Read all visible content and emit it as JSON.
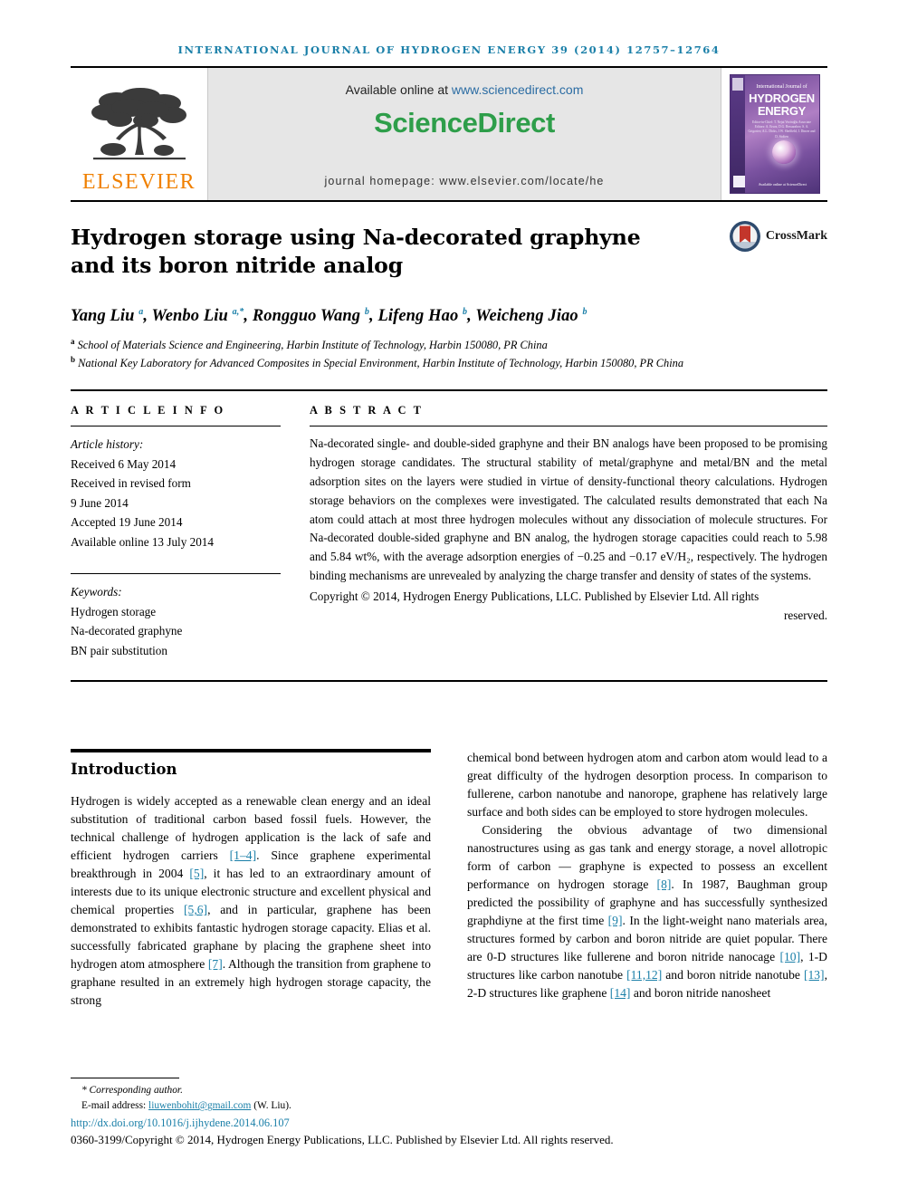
{
  "running_head": "INTERNATIONAL JOURNAL OF HYDROGEN ENERGY 39 (2014) 12757–12764",
  "masthead": {
    "publisher": "ELSEVIER",
    "available_prefix": "Available online at ",
    "available_url": "www.sciencedirect.com",
    "sciencedirect_part1": "Science",
    "sciencedirect_part2": "Direct",
    "homepage": "journal homepage: www.elsevier.com/locate/he",
    "cover": {
      "line_top": "International Journal of",
      "line_1": "HYDROGEN",
      "line_2": "ENERGY",
      "editors": "Editor-in-Chief: T. Nejat Veziroğlu\nAssociate Editors: A. Ersoz, D.G. Bessarabov, S. A. Grigoriev,\nA.L. Dicks, J.W. Sheffield,\nI. Dincer and D. Stolten",
      "footer": "Available online at ScienceDirect"
    }
  },
  "article": {
    "title": "Hydrogen storage using Na-decorated graphyne and its boron nitride analog",
    "crossmark_label": "CrossMark",
    "authors": [
      {
        "name": "Yang Liu",
        "sup": "a"
      },
      {
        "name": "Wenbo Liu",
        "sup": "a,*"
      },
      {
        "name": "Rongguo Wang",
        "sup": "b"
      },
      {
        "name": "Lifeng Hao",
        "sup": "b"
      },
      {
        "name": "Weicheng Jiao",
        "sup": "b"
      }
    ],
    "affiliations": [
      {
        "marker": "a",
        "text": "School of Materials Science and Engineering, Harbin Institute of Technology, Harbin 150080, PR China"
      },
      {
        "marker": "b",
        "text": "National Key Laboratory for Advanced Composites in Special Environment, Harbin Institute of Technology, Harbin 150080, PR China"
      }
    ]
  },
  "article_info": {
    "heading": "A R T I C L E   I N F O",
    "history_label": "Article history:",
    "history": [
      "Received 6 May 2014",
      "Received in revised form",
      "9 June 2014",
      "Accepted 19 June 2014",
      "Available online 13 July 2014"
    ],
    "keywords_label": "Keywords:",
    "keywords": [
      "Hydrogen storage",
      "Na-decorated graphyne",
      "BN pair substitution"
    ]
  },
  "abstract": {
    "heading": "A B S T R A C T",
    "body": "Na-decorated single- and double-sided graphyne and their BN analogs have been proposed to be promising hydrogen storage candidates. The structural stability of metal/graphyne and metal/BN and the metal adsorption sites on the layers were studied in virtue of density-functional theory calculations. Hydrogen storage behaviors on the complexes were investigated. The calculated results demonstrated that each Na atom could attach at most three hydrogen molecules without any dissociation of molecule structures. For Na-decorated double-sided graphyne and BN analog, the hydrogen storage capacities could reach to 5.98 and 5.84 wt%, with the average adsorption energies of −0.25 and −0.17 eV/H₂, respectively. The hydrogen binding mechanisms are unrevealed by analyzing the charge transfer and density of states of the systems.",
    "copyright_main": "Copyright © 2014, Hydrogen Energy Publications, LLC. Published by Elsevier Ltd. All rights",
    "copyright_tail": "reserved."
  },
  "introduction": {
    "heading": "Introduction",
    "left_paragraph_parts": [
      "Hydrogen is widely accepted as a renewable clean energy and an ideal substitution of traditional carbon based fossil fuels. However, the technical challenge of hydrogen application is the lack of safe and efficient hydrogen carriers ",
      "[1–4]",
      ". Since graphene experimental breakthrough in 2004 ",
      "[5]",
      ", it has led to an extraordinary amount of interests due to its unique electronic structure and excellent physical and chemical properties ",
      "[5,6]",
      ", and in particular, graphene has been demonstrated to exhibits fantastic hydrogen storage capacity. Elias et al. successfully fabricated graphane by placing the graphene sheet into hydrogen atom atmosphere ",
      "[7]",
      ". Although the transition from graphene to graphane resulted in an extremely high hydrogen storage capacity, the strong"
    ],
    "right_paragraph1": "chemical bond between hydrogen atom and carbon atom would lead to a great difficulty of the hydrogen desorption process. In comparison to fullerene, carbon nanotube and nanorope, graphene has relatively large surface and both sides can be employed to store hydrogen molecules.",
    "right_paragraph2_parts": [
      "Considering the obvious advantage of two dimensional nanostructures using as gas tank and energy storage, a novel allotropic form of carbon — graphyne is expected to possess an excellent performance on hydrogen storage ",
      "[8]",
      ". In 1987, Baughman group predicted the possibility of graphyne and has successfully synthesized graphdiyne at the first time ",
      "[9]",
      ". In the light-weight nano materials area, structures formed by carbon and boron nitride are quiet popular. There are 0-D structures like fullerene and boron nitride nanocage ",
      "[10]",
      ", 1-D structures like carbon nanotube ",
      "[11,12]",
      " and boron nitride nanotube ",
      "[13]",
      ", 2-D structures like graphene ",
      "[14]",
      " and boron nitride nanosheet"
    ]
  },
  "footer": {
    "corresponding": "* Corresponding author.",
    "email_label": "E-mail address: ",
    "email": "liuwenbohit@gmail.com",
    "email_suffix": " (W. Liu).",
    "doi": "http://dx.doi.org/10.1016/j.ijhydene.2014.06.107",
    "issn_copyright": "0360-3199/Copyright © 2014, Hydrogen Energy Publications, LLC. Published by Elsevier Ltd. All rights reserved."
  },
  "colors": {
    "link_blue": "#1a7fa8",
    "elsevier_orange": "#f08000",
    "sciencedirect_green": "#2e9e4a",
    "banner_grey": "#e6e6e6"
  }
}
